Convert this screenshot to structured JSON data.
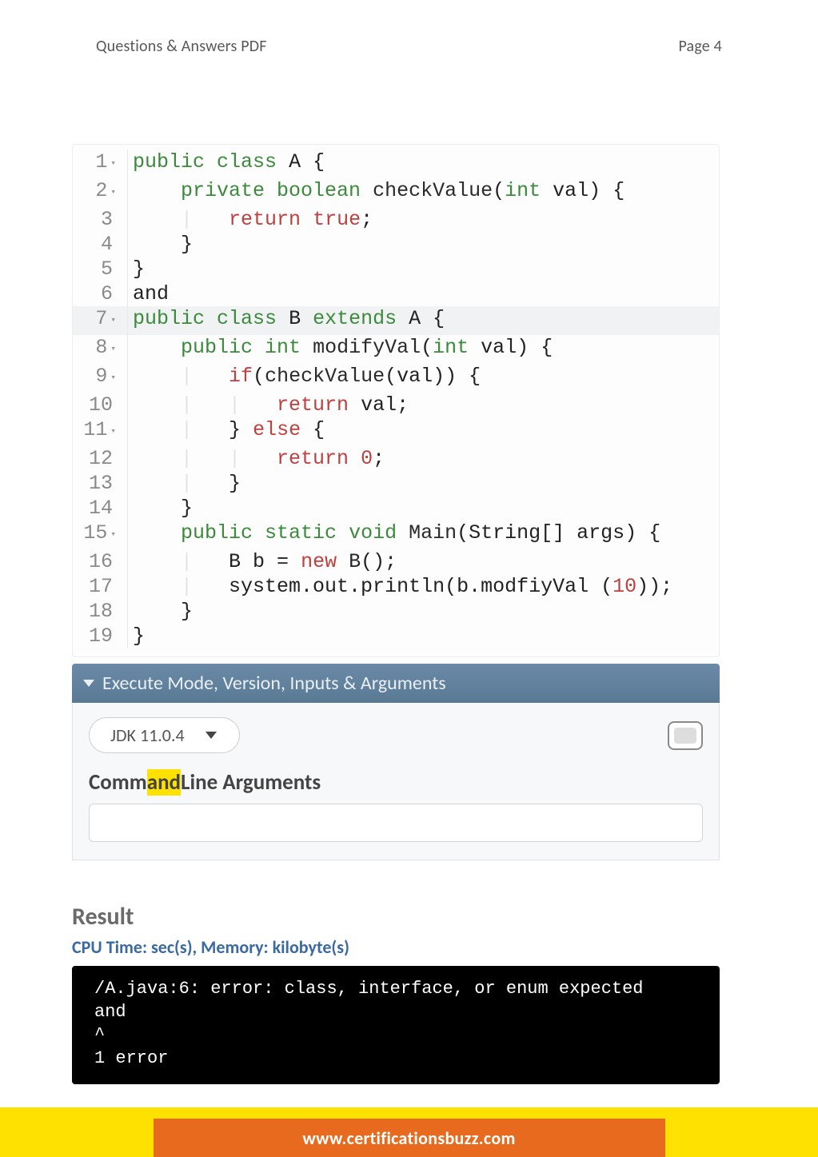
{
  "header": {
    "left": "Questions & Answers PDF",
    "right": "Page 4"
  },
  "code": {
    "lines": [
      {
        "n": "1",
        "fold": true,
        "hl": false,
        "tokens": [
          [
            "k-public",
            "public"
          ],
          [
            "plain",
            " "
          ],
          [
            "k-class",
            "class"
          ],
          [
            "plain",
            " "
          ],
          [
            "ident",
            "A"
          ],
          [
            "plain",
            " "
          ],
          [
            "brace",
            "{"
          ]
        ]
      },
      {
        "n": "2",
        "fold": true,
        "hl": false,
        "tokens": [
          [
            "plain",
            "    "
          ],
          [
            "k-type",
            "private boolean"
          ],
          [
            "plain",
            " "
          ],
          [
            "fn",
            "checkValue"
          ],
          [
            "punct",
            "("
          ],
          [
            "typeN",
            "int"
          ],
          [
            "plain",
            " "
          ],
          [
            "ident",
            "val"
          ],
          [
            "punct",
            ") "
          ],
          [
            "brace",
            "{"
          ]
        ]
      },
      {
        "n": "3",
        "fold": false,
        "hl": false,
        "tokens": [
          [
            "guide",
            "    |   "
          ],
          [
            "k-return",
            "return"
          ],
          [
            "plain",
            " "
          ],
          [
            "k-true",
            "true"
          ],
          [
            "punct",
            ";"
          ]
        ]
      },
      {
        "n": "4",
        "fold": false,
        "hl": false,
        "tokens": [
          [
            "plain",
            "    "
          ],
          [
            "brace",
            "}"
          ]
        ]
      },
      {
        "n": "5",
        "fold": false,
        "hl": false,
        "tokens": [
          [
            "brace",
            "}"
          ]
        ]
      },
      {
        "n": "6",
        "fold": false,
        "hl": false,
        "tokens": [
          [
            "plain",
            "and"
          ]
        ]
      },
      {
        "n": "7",
        "fold": true,
        "hl": true,
        "tokens": [
          [
            "k-public",
            "public"
          ],
          [
            "plain",
            " "
          ],
          [
            "k-class",
            "class"
          ],
          [
            "plain",
            " "
          ],
          [
            "ident",
            "B"
          ],
          [
            "plain",
            " "
          ],
          [
            "k-extends",
            "extends"
          ],
          [
            "plain",
            " "
          ],
          [
            "ident",
            "A"
          ],
          [
            "plain",
            " "
          ],
          [
            "brace",
            "{"
          ]
        ]
      },
      {
        "n": "8",
        "fold": true,
        "hl": false,
        "tokens": [
          [
            "plain",
            "    "
          ],
          [
            "k-public",
            "public"
          ],
          [
            "plain",
            " "
          ],
          [
            "typeN",
            "int"
          ],
          [
            "plain",
            " "
          ],
          [
            "fn",
            "modifyVal"
          ],
          [
            "punct",
            "("
          ],
          [
            "typeN",
            "int"
          ],
          [
            "plain",
            " "
          ],
          [
            "ident",
            "val"
          ],
          [
            "punct",
            ") "
          ],
          [
            "brace",
            "{"
          ]
        ]
      },
      {
        "n": "9",
        "fold": true,
        "hl": false,
        "tokens": [
          [
            "guide",
            "    |   "
          ],
          [
            "k-return",
            "if"
          ],
          [
            "punct",
            "("
          ],
          [
            "fn",
            "checkValue"
          ],
          [
            "punct",
            "("
          ],
          [
            "ident",
            "val"
          ],
          [
            "punct",
            ")) "
          ],
          [
            "brace",
            "{"
          ]
        ]
      },
      {
        "n": "10",
        "fold": false,
        "hl": false,
        "tokens": [
          [
            "guide",
            "    |   |   "
          ],
          [
            "k-return",
            "return"
          ],
          [
            "plain",
            " "
          ],
          [
            "ident",
            "val"
          ],
          [
            "punct",
            ";"
          ]
        ]
      },
      {
        "n": "11",
        "fold": true,
        "hl": false,
        "tokens": [
          [
            "guide",
            "    |   "
          ],
          [
            "brace",
            "}"
          ],
          [
            "plain",
            " "
          ],
          [
            "k-else",
            "else"
          ],
          [
            "plain",
            " "
          ],
          [
            "brace",
            "{"
          ]
        ]
      },
      {
        "n": "12",
        "fold": false,
        "hl": false,
        "tokens": [
          [
            "guide",
            "    |   |   "
          ],
          [
            "k-return",
            "return"
          ],
          [
            "plain",
            " "
          ],
          [
            "num",
            "0"
          ],
          [
            "punct",
            ";"
          ]
        ]
      },
      {
        "n": "13",
        "fold": false,
        "hl": false,
        "tokens": [
          [
            "guide",
            "    |   "
          ],
          [
            "brace",
            "}"
          ]
        ]
      },
      {
        "n": "14",
        "fold": false,
        "hl": false,
        "tokens": [
          [
            "plain",
            "    "
          ],
          [
            "brace",
            "}"
          ]
        ]
      },
      {
        "n": "15",
        "fold": true,
        "hl": false,
        "tokens": [
          [
            "plain",
            "    "
          ],
          [
            "k-public",
            "public"
          ],
          [
            "plain",
            " "
          ],
          [
            "k-type",
            "static"
          ],
          [
            "plain",
            " "
          ],
          [
            "k-void",
            "void"
          ],
          [
            "plain",
            " "
          ],
          [
            "fn",
            "Main"
          ],
          [
            "punct",
            "("
          ],
          [
            "ident",
            "String"
          ],
          [
            "punct",
            "[] "
          ],
          [
            "ident",
            "args"
          ],
          [
            "punct",
            ") "
          ],
          [
            "brace",
            "{"
          ]
        ]
      },
      {
        "n": "16",
        "fold": false,
        "hl": false,
        "tokens": [
          [
            "guide",
            "    |   "
          ],
          [
            "ident",
            "B b"
          ],
          [
            "plain",
            " = "
          ],
          [
            "k-new",
            "new"
          ],
          [
            "plain",
            " "
          ],
          [
            "fn",
            "B"
          ],
          [
            "punct",
            "();"
          ]
        ]
      },
      {
        "n": "17",
        "fold": false,
        "hl": false,
        "tokens": [
          [
            "guide",
            "    |   "
          ],
          [
            "ident",
            "system.out.println"
          ],
          [
            "punct",
            "("
          ],
          [
            "ident",
            "b.modfiyVal"
          ],
          [
            "plain",
            " "
          ],
          [
            "punct",
            "("
          ],
          [
            "num",
            "10"
          ],
          [
            "punct",
            "));"
          ]
        ]
      },
      {
        "n": "18",
        "fold": false,
        "hl": false,
        "tokens": [
          [
            "plain",
            "    "
          ],
          [
            "brace",
            "}"
          ]
        ]
      },
      {
        "n": "19",
        "fold": false,
        "hl": false,
        "tokens": [
          [
            "brace",
            "}"
          ]
        ]
      }
    ]
  },
  "exec": {
    "header": "Execute Mode, Version, Inputs & Arguments",
    "jdk": "JDK 11.0.4",
    "cmd_label_pre": "Comm",
    "cmd_label_hl": "and",
    "cmd_label_post": "Line Arguments"
  },
  "result": {
    "title": "Result",
    "subtitle": "CPU Time: sec(s), Memory: kilobyte(s)",
    "terminal": "/A.java:6: error: class, interface, or enum expected\nand\n^\n1 error"
  },
  "footer": {
    "url": "www.certificationsbuzz.com"
  }
}
